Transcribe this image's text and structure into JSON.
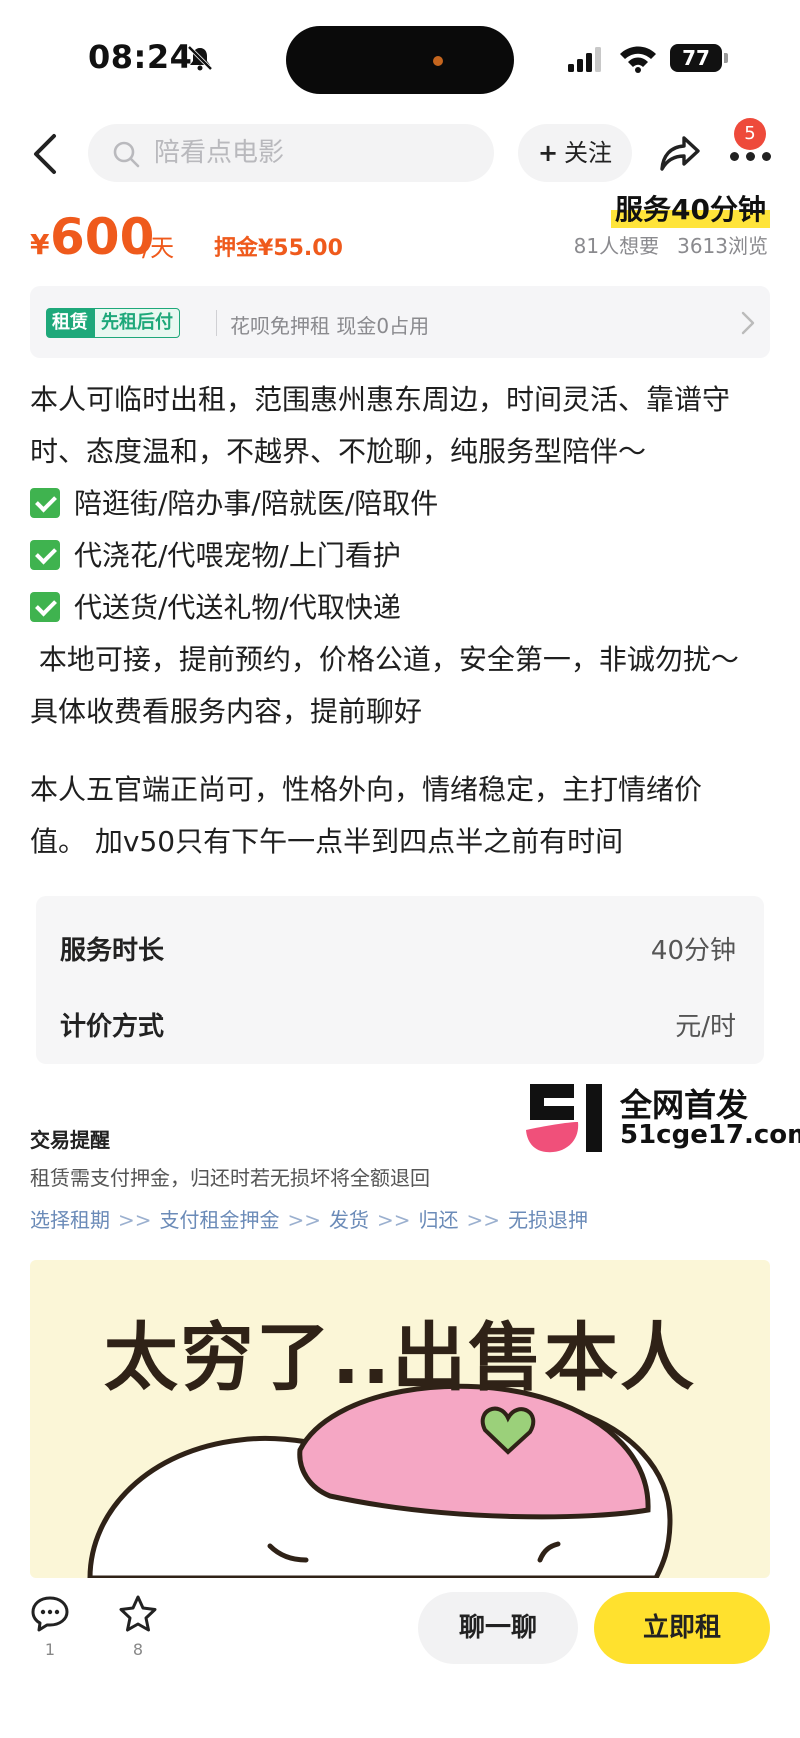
{
  "status_bar": {
    "time": "08:24",
    "battery": "77"
  },
  "header": {
    "search_placeholder": "陪看点电影",
    "follow_label": "关注",
    "follow_plus": "+",
    "more_badge": "5"
  },
  "price": {
    "yen": "¥",
    "value": "600",
    "unit": "/天",
    "deposit": "押金¥55.00"
  },
  "service_tag": "服务40分钟",
  "stats": {
    "wants": "81人想要",
    "views": "3613浏览"
  },
  "rent_banner": {
    "logo_a": "租赁",
    "logo_b": "先租后付",
    "text": "花呗免押租  现金0占用"
  },
  "description": {
    "line1": "本人可临时出租，范围惠州惠东周边，时间灵活、靠谱守",
    "line2": "时、态度温和，不越界、不尬聊，纯服务型陪伴～",
    "check_items": [
      "陪逛街/陪办事/陪就医/陪取件",
      "代浇花/代喂宠物/上门看护",
      "代送货/代送礼物/代取快递"
    ],
    "line3": " 本地可接，提前预约，价格公道，安全第一，非诚勿扰～",
    "line4": "具体收费看服务内容，提前聊好",
    "line5": "本人五官端正尚可，性格外向，情绪稳定，主打情绪价",
    "line6": "值。 加v50只有下午一点半到四点半之前有时间"
  },
  "info": {
    "rows": [
      {
        "label": "服务时长",
        "value": "40分钟"
      },
      {
        "label": "计价方式",
        "value": "元/时"
      }
    ]
  },
  "watermark": {
    "line1": "全网首发",
    "line2": "51cge17.com"
  },
  "trade": {
    "title": "交易提醒",
    "desc": "租赁需支付押金，归还时若无损坏将全额退回",
    "steps": [
      "选择租期",
      "支付租金押金",
      "发货",
      "归还",
      "无损退押"
    ],
    "separator": ">>"
  },
  "hero": {
    "title": "太穷了..出售本人"
  },
  "bottom_bar": {
    "comment_count": "1",
    "favorite_count": "8",
    "chat_label": "聊一聊",
    "rent_label": "立即租"
  },
  "colors": {
    "accent": "#ef5a1c",
    "highlight": "#ffe43a",
    "rent_button": "#ffe12e",
    "check": "#3fb34f",
    "badge": "#ee4a3b"
  }
}
